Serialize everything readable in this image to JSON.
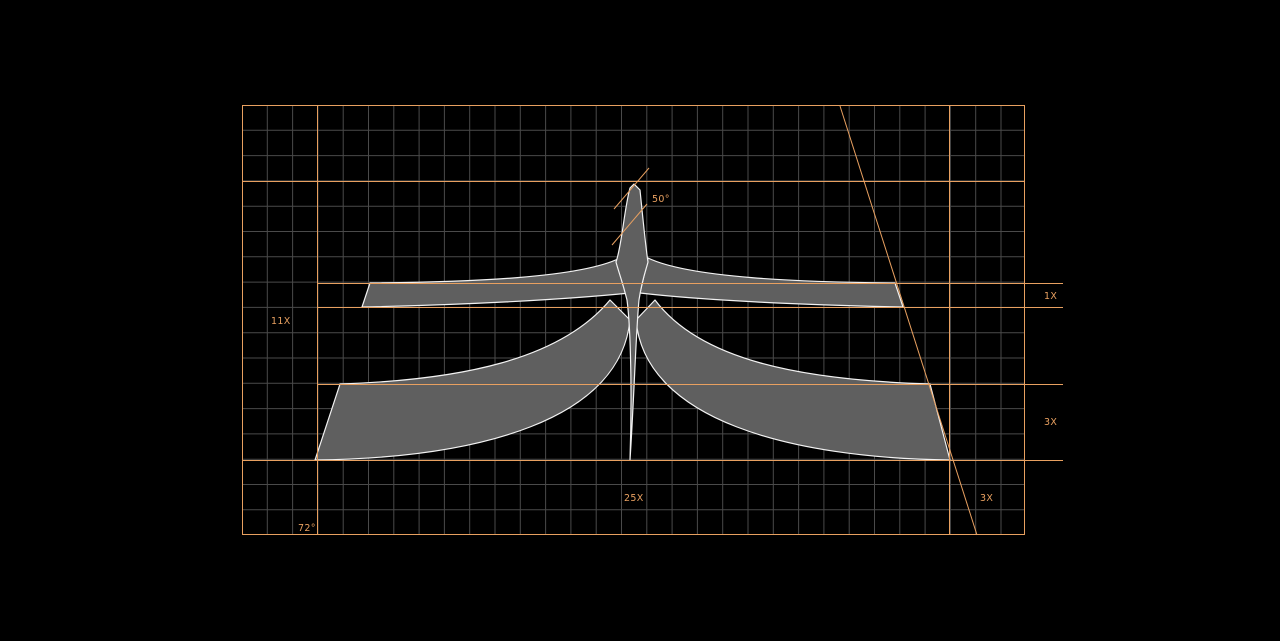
{
  "colors": {
    "background": "#000000",
    "guide": "#e8a060",
    "grid": "#4a4a4a",
    "fill": "#5f5f5f",
    "stroke": "#f2f2f2"
  },
  "labels": {
    "angle_top": "50°",
    "angle_bottom": "72°",
    "ratio_left": "11X",
    "ratio_right_upper": "1X",
    "ratio_right_lower": "3X",
    "ratio_bottom_center": "25X",
    "ratio_bottom_right": "3X"
  }
}
